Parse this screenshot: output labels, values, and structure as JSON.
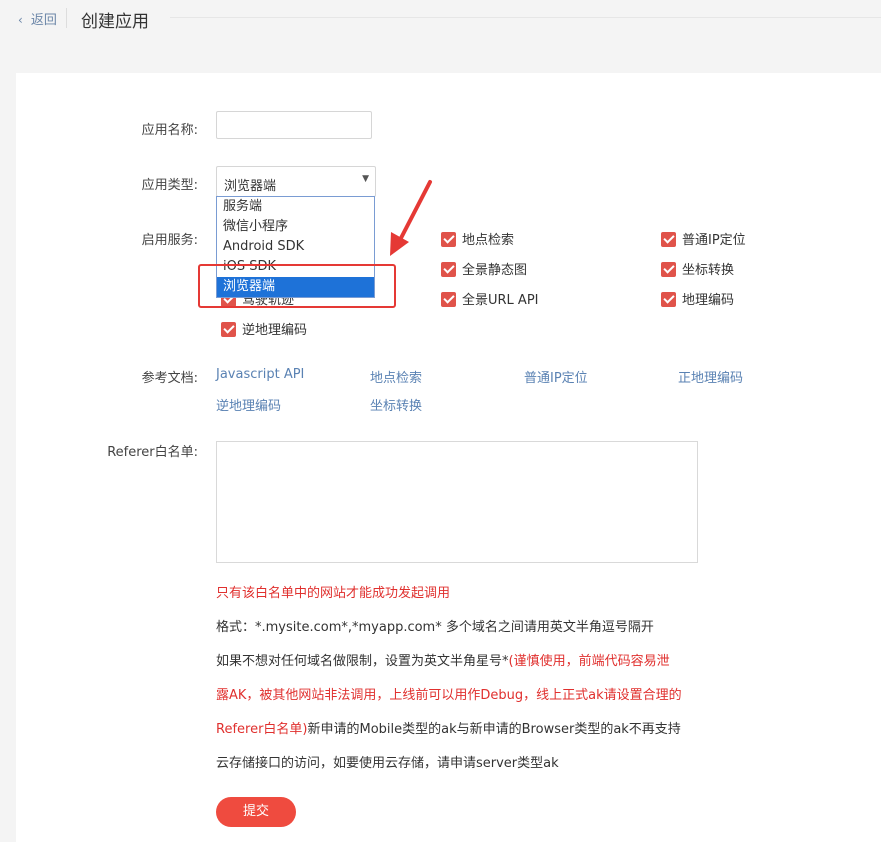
{
  "header": {
    "back_label": "返回",
    "title": "创建应用"
  },
  "form": {
    "app_name_label": "应用名称:",
    "app_name_value": "",
    "app_type_label": "应用类型:",
    "app_type_selected": "浏览器端",
    "app_type_options": [
      "服务端",
      "微信小程序",
      "Android SDK",
      "iOS SDK",
      "浏览器端"
    ],
    "services_label": "启用服务:",
    "services": {
      "col1_hidden": "驾驶轨迹",
      "reverse_geocode": "逆地理编码",
      "place_search": "地点检索",
      "panorama_static": "全景静态图",
      "panorama_url": "全景URL API",
      "ip_location": "普通IP定位",
      "coord_convert": "坐标转换",
      "geocode": "地理编码"
    },
    "docs_label": "参考文档:",
    "docs": [
      "Javascript API",
      "地点检索",
      "普通IP定位",
      "正地理编码",
      "逆地理编码",
      "坐标转换"
    ],
    "referer_label": "Referer白名单:",
    "referer_value": "",
    "notes": {
      "line1": "只有该白名单中的网站才能成功发起调用",
      "line2": "格式：*.mysite.com*,*myapp.com* 多个域名之间请用英文半角逗号隔开",
      "line3_a": "如果不想对任何域名做限制，设置为英文半角星号*",
      "line3_b": "(谨慎使用，前端代码容易泄",
      "line4": "露AK，被其他网站非法调用，上线前可以用作Debug，线上正式ak请设置合理的",
      "line5_a": "Referer白名单)",
      "line5_b": "新申请的Mobile类型的ak与新申请的Browser类型的ak不再支持",
      "line6": "云存储接口的访问，如要使用云存储，请申请server类型ak"
    },
    "submit_label": "提交"
  },
  "colors": {
    "accent": "#ef4b3f",
    "checkbox": "#e0534a",
    "link": "#5a82b3",
    "warning": "#e0302e",
    "annotation": "#e53935"
  }
}
